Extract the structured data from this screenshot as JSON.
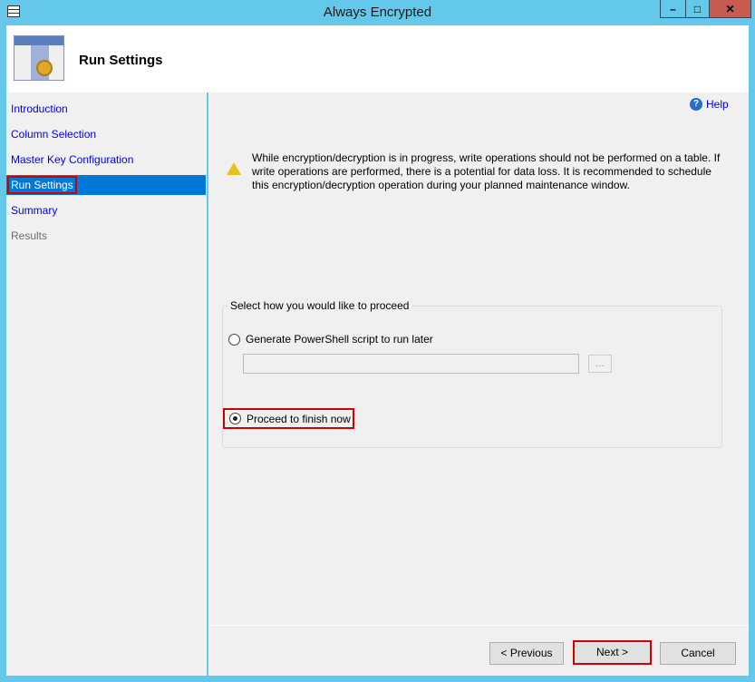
{
  "window": {
    "title": "Always Encrypted",
    "minimize": "–",
    "maximize": "□",
    "close": "✕"
  },
  "header": {
    "title": "Run Settings"
  },
  "sidebar": {
    "items": [
      {
        "label": "Introduction"
      },
      {
        "label": "Column Selection"
      },
      {
        "label": "Master Key Configuration"
      },
      {
        "label": "Run Settings"
      },
      {
        "label": "Summary"
      },
      {
        "label": "Results"
      }
    ]
  },
  "help": {
    "label": "Help"
  },
  "warning": {
    "text": "While encryption/decryption is in progress, write operations should not be performed on a table. If write operations are performed, there is a potential for data loss. It is recommended to schedule this encryption/decryption operation during your planned maintenance window."
  },
  "proceed": {
    "legend": "Select how you would like to proceed",
    "option_script": "Generate PowerShell script to run later",
    "script_path": "",
    "browse": "...",
    "option_now": "Proceed to finish now",
    "selected": "now"
  },
  "buttons": {
    "previous": "< Previous",
    "next": "Next >",
    "cancel": "Cancel"
  }
}
